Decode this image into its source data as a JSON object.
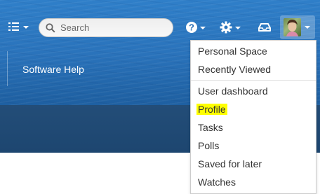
{
  "header": {
    "space_title": "Software Help",
    "search": {
      "placeholder": "Search",
      "value": ""
    },
    "icons": {
      "menu": "menu-icon",
      "help": "help-icon",
      "settings": "gear-icon",
      "notifications": "inbox-icon",
      "user": "avatar"
    }
  },
  "user_menu": {
    "items": [
      {
        "label": "Personal Space"
      },
      {
        "label": "Recently Viewed"
      },
      {
        "label": "User dashboard"
      },
      {
        "label": "Profile",
        "highlighted": true
      },
      {
        "label": "Tasks"
      },
      {
        "label": "Polls"
      },
      {
        "label": "Saved for later"
      },
      {
        "label": "Watches"
      }
    ]
  },
  "colors": {
    "header_blue": "#2a73bb",
    "band_dark_blue": "#1d4670",
    "highlight_yellow": "#ffff00"
  }
}
